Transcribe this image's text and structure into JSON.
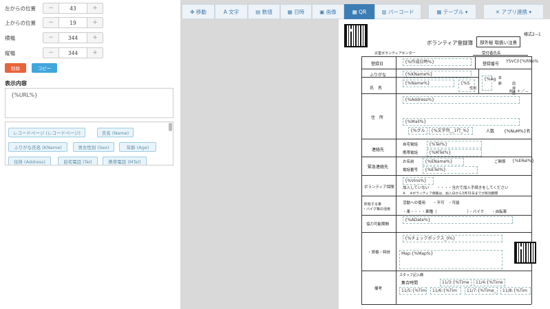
{
  "left_panel": {
    "fields": [
      {
        "label": "左からの位置",
        "value": "43"
      },
      {
        "label": "上からの位置",
        "value": "19"
      },
      {
        "label": "横幅",
        "value": "344"
      },
      {
        "label": "縦幅",
        "value": "344"
      }
    ],
    "minus": "−",
    "plus": "+",
    "delete_label": "削除",
    "copy_label": "コピー",
    "content_title": "表示内容",
    "content_value": "{%URL%}",
    "tags": [
      "レコードページ (レコードページ)",
      "氏名 (Name)",
      "ふりがな氏名 (KName)",
      "男女性別 (Sex)",
      "年齢 (Age)",
      "住所 (Address)",
      "自宅電話 (Tel)",
      "携帯電話 (MTel)"
    ]
  },
  "toolbar": {
    "items": [
      "✥ 移動",
      "A 文字",
      "▤ 数値",
      "▦ 日時",
      "▣ 画像",
      "▦ QR",
      "▥ バーコード",
      "▦ テーブル ▾",
      "✕ アプリ連携 ▾"
    ]
  },
  "doc": {
    "style_no": "様式2−1",
    "title": "ボランティア登録簿",
    "confidential": "部外秘 取扱い注意",
    "org": "災害ボランティアセンター",
    "receptionist": "受付者氏名",
    "reg_date_lbl": "登録日",
    "reg_date_val": "{%作成日時%}",
    "reg_no_lbl": "登録番号",
    "reg_no_val": "YSVC0{%RNo%",
    "furigana_lbl": "ふりがな",
    "furigana_val": "{%KName%}",
    "name_lbl": "氏　名",
    "name_val": "{%Name%}",
    "sex_val": "{%S",
    "sex_lbl": "性別",
    "age_val": "{%Ag",
    "age_lbl": "年齢",
    "blood_lbl": "血液型",
    "blood_val": "RH ＋／−",
    "address_lbl": "住　所",
    "address_val": "{%Address%}",
    "mail_val": "{%Mail%}",
    "group_val": "{%グル",
    "group_val2": "{%文字列__1行_%}",
    "people_lbl": "人数",
    "people_val": "{%NuM%}名",
    "contact_lbl": "連絡先",
    "home_tel_lbl": "自宅電話",
    "home_tel_val": "{%Tel%}",
    "mobile_lbl": "携帯電話",
    "mobile_val": "{%MTel%}",
    "emergency_lbl": "緊急連絡先",
    "em_name_lbl": "お名前",
    "em_name_val": "{%EName%}",
    "relation_lbl": "ご関係",
    "relation_val": "{%ERel%}",
    "em_tel_lbl": "電話番号",
    "em_tel_val": "{%ETel%}",
    "insurance_lbl": "ボランティア保険",
    "insurance_val": "{%VIns%}",
    "ins_note1": "加入していない　　・・・・当方で加入手続きをしてください",
    "ins_note2": "※ 　※ボランティア保険は、加入日から3月31日までが有効期間",
    "vehicle_lbl1": "所有する車",
    "vehicle_lbl2": "・バイク等の活用",
    "vehicle_l1": "活動への使用　　・不可　・可能",
    "vehicle_l2": "・車・・・・車種（　　　　　　　　）・バイク　　・自転車",
    "period_lbl": "協力可能期間",
    "period_val": "{%ADate%}",
    "skills_lbl": "・資格・特技",
    "check_val": "{%チェックボックス_0%}",
    "map_val": "Map:{%Map%}",
    "staff_lbl": "スタッフ記入欄",
    "remarks_lbl": "備考",
    "gather_lbl": "集合時間",
    "t1": "11/3:{%Time",
    "t2": "11/4:{%Time",
    "t3": "11/5:{%Tim",
    "t4": "11/6:{%Tim",
    "t5": "11/7:{%Time_",
    "t6": "11/8:{%Tim"
  }
}
